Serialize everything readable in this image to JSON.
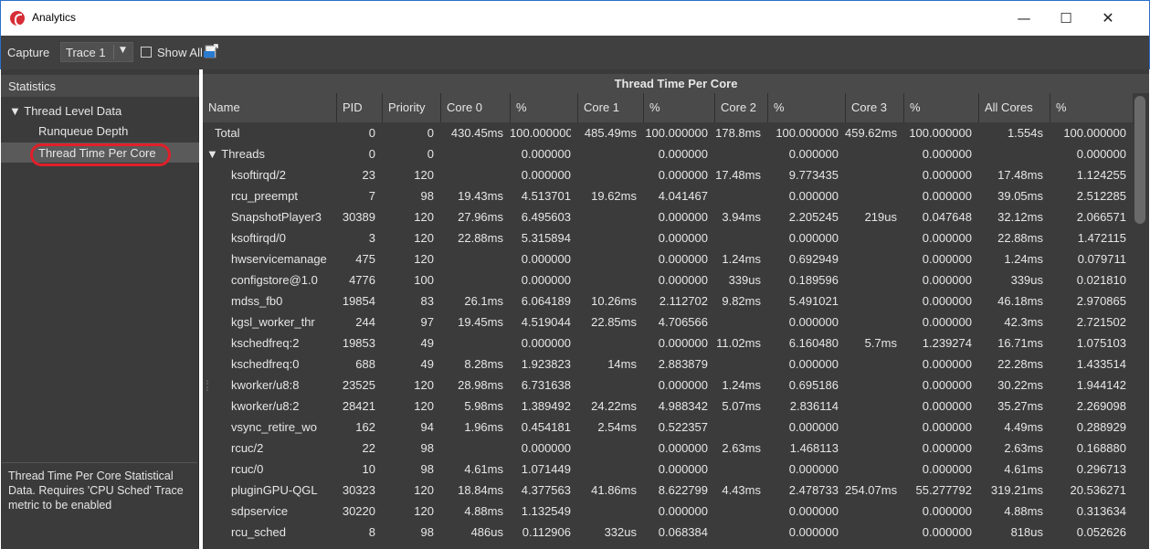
{
  "window": {
    "title": "Analytics",
    "controls": {
      "minimize": "—",
      "maximize": "☐",
      "close": "✕"
    }
  },
  "toolbar": {
    "capture_label": "Capture",
    "trace_value": "Trace 1",
    "show_all_label": "Show All",
    "export_icon": "csv-export-icon"
  },
  "statistics": {
    "header": "Statistics",
    "tree": {
      "parent": "Thread Level Data",
      "children": [
        "Runqueue Depth",
        "Thread Time Per Core"
      ]
    },
    "selected": "Thread Time Per Core",
    "description": "Thread Time Per Core Statistical Data. Requires 'CPU Sched' Trace metric to be enabled"
  },
  "table": {
    "title": "Thread Time Per Core",
    "columns": [
      "Name",
      "PID",
      "Priority",
      "Core 0",
      "%",
      "Core 1",
      "%",
      "Core 2",
      "%",
      "Core 3",
      "%",
      "All Cores",
      "%"
    ],
    "rows": [
      [
        "Total",
        "0",
        "0",
        "430.45ms",
        "100.000000",
        "485.49ms",
        "100.000000",
        "178.8ms",
        "100.000000",
        "459.62ms",
        "100.000000",
        "1.554s",
        "100.000000"
      ],
      [
        "Threads",
        "0",
        "0",
        "",
        "0.000000",
        "",
        "0.000000",
        "",
        "0.000000",
        "",
        "0.000000",
        "",
        "0.000000"
      ],
      [
        "ksoftirqd/2",
        "23",
        "120",
        "",
        "0.000000",
        "",
        "0.000000",
        "17.48ms",
        "9.773435",
        "",
        "0.000000",
        "17.48ms",
        "1.124255"
      ],
      [
        "rcu_preempt",
        "7",
        "98",
        "19.43ms",
        "4.513701",
        "19.62ms",
        "4.041467",
        "",
        "0.000000",
        "",
        "0.000000",
        "39.05ms",
        "2.512285"
      ],
      [
        "SnapshotPlayer3",
        "30389",
        "120",
        "27.96ms",
        "6.495603",
        "",
        "0.000000",
        "3.94ms",
        "2.205245",
        "219us",
        "0.047648",
        "32.12ms",
        "2.066571"
      ],
      [
        "ksoftirqd/0",
        "3",
        "120",
        "22.88ms",
        "5.315894",
        "",
        "0.000000",
        "",
        "0.000000",
        "",
        "0.000000",
        "22.88ms",
        "1.472115"
      ],
      [
        "hwservicemanage",
        "475",
        "120",
        "",
        "0.000000",
        "",
        "0.000000",
        "1.24ms",
        "0.692949",
        "",
        "0.000000",
        "1.24ms",
        "0.079711"
      ],
      [
        "configstore@1.0",
        "4776",
        "100",
        "",
        "0.000000",
        "",
        "0.000000",
        "339us",
        "0.189596",
        "",
        "0.000000",
        "339us",
        "0.021810"
      ],
      [
        "mdss_fb0",
        "19854",
        "83",
        "26.1ms",
        "6.064189",
        "10.26ms",
        "2.112702",
        "9.82ms",
        "5.491021",
        "",
        "0.000000",
        "46.18ms",
        "2.970865"
      ],
      [
        "kgsl_worker_thr",
        "244",
        "97",
        "19.45ms",
        "4.519044",
        "22.85ms",
        "4.706566",
        "",
        "0.000000",
        "",
        "0.000000",
        "42.3ms",
        "2.721502"
      ],
      [
        "kschedfreq:2",
        "19853",
        "49",
        "",
        "0.000000",
        "",
        "0.000000",
        "11.02ms",
        "6.160480",
        "5.7ms",
        "1.239274",
        "16.71ms",
        "1.075103"
      ],
      [
        "kschedfreq:0",
        "688",
        "49",
        "8.28ms",
        "1.923823",
        "14ms",
        "2.883879",
        "",
        "0.000000",
        "",
        "0.000000",
        "22.28ms",
        "1.433514"
      ],
      [
        "kworker/u8:8",
        "23525",
        "120",
        "28.98ms",
        "6.731638",
        "",
        "0.000000",
        "1.24ms",
        "0.695186",
        "",
        "0.000000",
        "30.22ms",
        "1.944142"
      ],
      [
        "kworker/u8:2",
        "28421",
        "120",
        "5.98ms",
        "1.389492",
        "24.22ms",
        "4.988342",
        "5.07ms",
        "2.836114",
        "",
        "0.000000",
        "35.27ms",
        "2.269098"
      ],
      [
        "vsync_retire_wo",
        "162",
        "94",
        "1.96ms",
        "0.454181",
        "2.54ms",
        "0.522357",
        "",
        "0.000000",
        "",
        "0.000000",
        "4.49ms",
        "0.288929"
      ],
      [
        "rcuc/2",
        "22",
        "98",
        "",
        "0.000000",
        "",
        "0.000000",
        "2.63ms",
        "1.468113",
        "",
        "0.000000",
        "2.63ms",
        "0.168880"
      ],
      [
        "rcuc/0",
        "10",
        "98",
        "4.61ms",
        "1.071449",
        "",
        "0.000000",
        "",
        "0.000000",
        "",
        "0.000000",
        "4.61ms",
        "0.296713"
      ],
      [
        "pluginGPU-QGL",
        "30323",
        "120",
        "18.84ms",
        "4.377563",
        "41.86ms",
        "8.622799",
        "4.43ms",
        "2.478733",
        "254.07ms",
        "55.277792",
        "319.21ms",
        "20.536271"
      ],
      [
        "sdpservice",
        "30220",
        "120",
        "4.88ms",
        "1.132549",
        "",
        "0.000000",
        "",
        "0.000000",
        "",
        "0.000000",
        "4.88ms",
        "0.313634"
      ],
      [
        "rcu_sched",
        "8",
        "98",
        "486us",
        "0.112906",
        "332us",
        "0.068384",
        "",
        "0.000000",
        "",
        "0.000000",
        "818us",
        "0.052626"
      ]
    ]
  }
}
